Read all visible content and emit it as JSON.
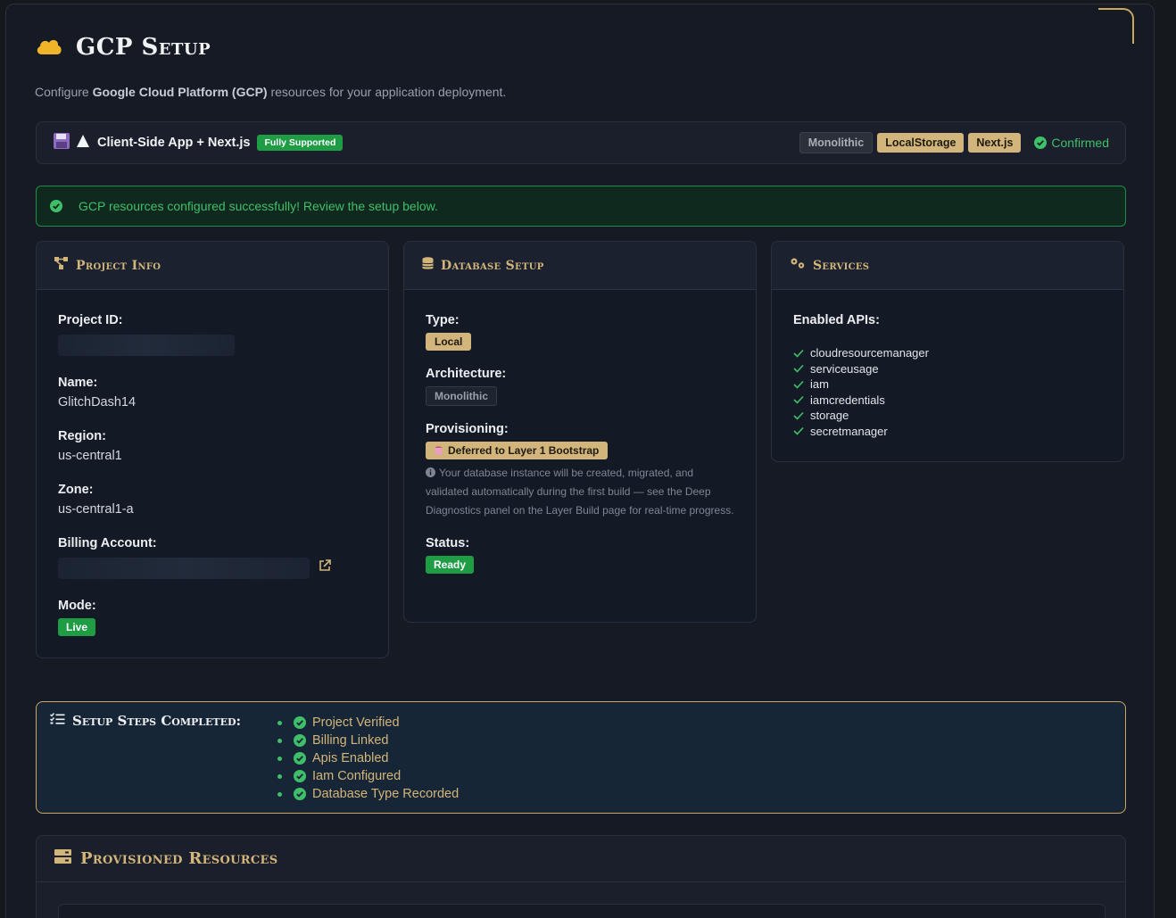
{
  "page": {
    "title": "GCP Setup",
    "subtitle_prefix": "Configure ",
    "subtitle_bold": "Google Cloud Platform (GCP)",
    "subtitle_suffix": " resources for your application deployment."
  },
  "stack": {
    "name": "Client-Side App + Next.js",
    "support_badge": "Fully Supported",
    "tags": [
      "Monolithic",
      "LocalStorage",
      "Next.js"
    ],
    "confirmed": "Confirmed"
  },
  "alert": {
    "message": "GCP resources configured successfully! Review the setup below."
  },
  "project_info": {
    "title": "Project Info",
    "project_id_label": "Project ID:",
    "name_label": "Name:",
    "name_value": "GlitchDash14",
    "region_label": "Region:",
    "region_value": "us-central1",
    "zone_label": "Zone:",
    "zone_value": "us-central1-a",
    "billing_label": "Billing Account:",
    "mode_label": "Mode:",
    "mode_value": "Live"
  },
  "database": {
    "title": "Database Setup",
    "type_label": "Type:",
    "type_value": "Local",
    "arch_label": "Architecture:",
    "arch_value": "Monolithic",
    "prov_label": "Provisioning:",
    "prov_value": "Deferred to Layer 1 Bootstrap",
    "note": "Your database instance will be created, migrated, and validated automatically during the first build — see the Deep Diagnostics panel on the Layer Build page for real-time progress.",
    "status_label": "Status:",
    "status_value": "Ready"
  },
  "services": {
    "title": "Services",
    "apis_label": "Enabled APIs:",
    "apis": [
      "cloudresourcemanager",
      "serviceusage",
      "iam",
      "iamcredentials",
      "storage",
      "secretmanager"
    ]
  },
  "steps": {
    "title": "Setup Steps Completed:",
    "items": [
      "Project Verified",
      "Billing Linked",
      "Apis Enabled",
      "Iam Configured",
      "Database Type Recorded"
    ]
  },
  "resources": {
    "title": "Provisioned Resources"
  },
  "colors": {
    "accent_gold": "#d2b57a",
    "success_green": "#3fbf6a",
    "badge_green": "#1f9d45"
  }
}
